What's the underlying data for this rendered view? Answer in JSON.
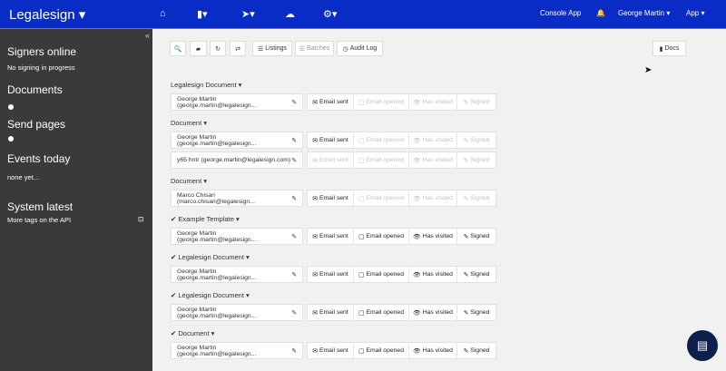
{
  "topbar": {
    "brand": "Legalesign ▾",
    "icons": [
      "home-icon",
      "file-icon",
      "send-icon",
      "cloud-upload-icon",
      "gear-icon"
    ],
    "console": "Console App",
    "user": "George Martin ▾",
    "app": "App ▾"
  },
  "sidebar": {
    "signers_title": "Signers online",
    "signers_text": "No signing in progress",
    "documents_title": "Documents",
    "send_title": "Send pages",
    "events_title": "Events today",
    "events_text": "none yet...",
    "system_title": "System latest",
    "system_text": "More tags on the API"
  },
  "toolbar": {
    "listings": "Listings",
    "batches": "Batches",
    "audit": "Audit Log",
    "docs": "Docs"
  },
  "status_labels": [
    "Email sent",
    "Email opened",
    "Has visited",
    "Signed"
  ],
  "groups": [
    {
      "title": "Legalesign Document ▾",
      "rows": [
        {
          "recipient": "George Martin (george.martin@legalesign...",
          "states": [
            1,
            0,
            0,
            0
          ]
        }
      ]
    },
    {
      "title": "Document ▾",
      "rows": [
        {
          "recipient": "George Martin (george.martin@legalesign...",
          "states": [
            1,
            0,
            0,
            0
          ]
        },
        {
          "recipient": "y65 hntr (george.martin@legalesign.com)",
          "states": [
            0,
            0,
            0,
            0
          ]
        }
      ]
    },
    {
      "title": "Document ▾",
      "rows": [
        {
          "recipient": "Marco Chisari (marco.chisari@legalesign...",
          "states": [
            1,
            0,
            0,
            0
          ]
        }
      ]
    },
    {
      "title": "✔ Example Template ▾",
      "rows": [
        {
          "recipient": "George Martin (george.martin@legalesign...",
          "states": [
            1,
            1,
            1,
            1
          ]
        }
      ]
    },
    {
      "title": "✔ Legalesign Document ▾",
      "rows": [
        {
          "recipient": "George Martin (george.martin@legalesign...",
          "states": [
            1,
            1,
            1,
            1
          ]
        }
      ]
    },
    {
      "title": "✔ Legalesign Document ▾",
      "rows": [
        {
          "recipient": "George Martin (george.martin@legalesign...",
          "states": [
            1,
            1,
            1,
            1
          ]
        }
      ]
    },
    {
      "title": "✔ Document ▾",
      "rows": [
        {
          "recipient": "George Martin (george.martin@legalesign...",
          "states": [
            1,
            1,
            1,
            1
          ]
        }
      ]
    }
  ]
}
